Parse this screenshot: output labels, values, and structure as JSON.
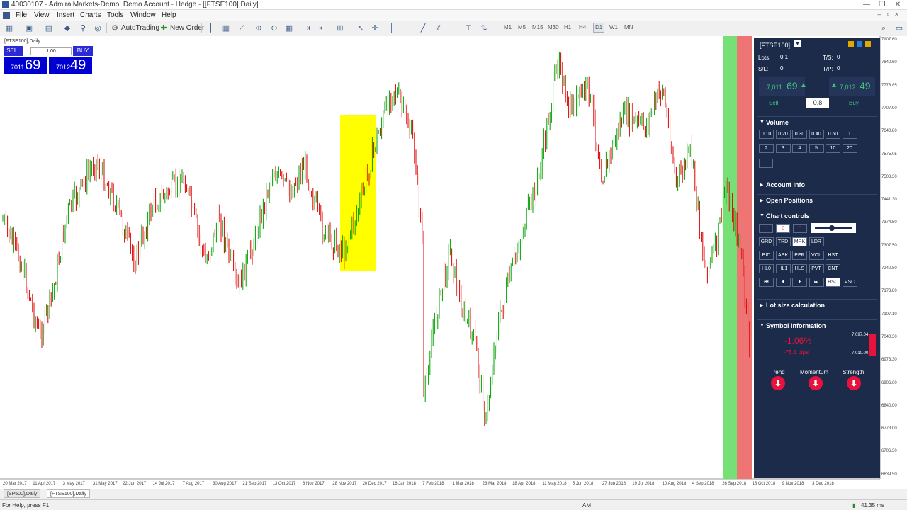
{
  "window": {
    "title": "40030107 - AdmiralMarkets-Demo: Demo Account - Hedge - [[FTSE100],Daily]",
    "controls": [
      "—",
      "❐",
      "✕"
    ]
  },
  "menu": [
    "File",
    "View",
    "Insert",
    "Charts",
    "Tools",
    "Window",
    "Help"
  ],
  "toolbar": {
    "autotrading_label": "AutoTrading",
    "new_order_label": "New Order",
    "timeframes": [
      "M1",
      "M5",
      "M15",
      "M30",
      "H1",
      "H4",
      "D1",
      "W1",
      "MN"
    ],
    "active_timeframe": "D1"
  },
  "chart": {
    "tag": "[FTSE100],Daily",
    "y_ticks": [
      "7907.60",
      "7840.60",
      "7773.85",
      "7707.90",
      "7640.80",
      "7575.05",
      "7508.30",
      "7441.30",
      "7374.50",
      "7307.50",
      "7240.80",
      "7173.80",
      "7107.10",
      "7040.30",
      "6973.30",
      "6906.60",
      "6840.00",
      "6773.00",
      "6706.30",
      "6639.50"
    ],
    "x_ticks": [
      "20 Mar 2017",
      "11 Apr 2017",
      "3 May 2017",
      "31 May 2017",
      "22 Jun 2017",
      "14 Jul 2017",
      "7 Aug 2017",
      "30 Aug 2017",
      "21 Sep 2017",
      "13 Oct 2017",
      "6 Nov 2017",
      "28 Nov 2017",
      "20 Dec 2017",
      "16 Jan 2018",
      "7 Feb 2018",
      "1 Mar 2018",
      "23 Mar 2018",
      "18 Apr 2018",
      "11 May 2018",
      "5 Jun 2018",
      "27 Jun 2018",
      "19 Jul 2018",
      "10 Aug 2018",
      "4 Sep 2018",
      "26 Sep 2018",
      "18 Oct 2018",
      "9 Nov 2018",
      "3 Dec 2018"
    ],
    "highlight_color": "#ffff00",
    "strip_colors": [
      "#6dde6d",
      "#ee6b6b"
    ]
  },
  "one_click": {
    "sell_label": "SELL",
    "buy_label": "BUY",
    "lots": "1.00",
    "sell_small": "7011",
    "sell_big": "69",
    "buy_small": "7012",
    "buy_big": "49"
  },
  "panel": {
    "symbol": "[FTSE100]",
    "lots_label": "Lots:",
    "lots_value": "0.1",
    "sl_label": "S/L:",
    "sl_value": "0",
    "ts_label": "T/S:",
    "ts_value": "0",
    "tp_label": "T/P:",
    "tp_value": "0",
    "sell_price_small": "7,011.",
    "sell_price_big": "69",
    "buy_price_small": "7,012.",
    "buy_price_big": "49",
    "sell_label": "Sell",
    "buy_label": "Buy",
    "spread": "0.8",
    "volume_title": "Volume",
    "volume_row1": [
      "0.10",
      "0.20",
      "0.30",
      "0.40",
      "0.50",
      "1"
    ],
    "volume_row2": [
      "2",
      "3",
      "4",
      "5",
      "10",
      "20"
    ],
    "volume_more": "...",
    "account_info": "Account info",
    "open_positions": "Open Positions",
    "chart_controls": "Chart controls",
    "cc_row1": [
      "GRD",
      "TRD",
      "MRK",
      "LDR"
    ],
    "cc_row2": [
      "BID",
      "ASK",
      "PER",
      "VOL",
      "HST"
    ],
    "cc_row3": [
      "HL0",
      "HL1",
      "HLS",
      "PVT",
      "CNT"
    ],
    "cc_row4": [
      "⏮",
      "⏴",
      "⏵",
      "⏭",
      "HSC",
      "VSC"
    ],
    "lot_size_calc": "Lot size calculation",
    "symbol_info": "Symbol information",
    "change_pct": "-1.06%",
    "change_pips": "-75.1 pips",
    "high_value": "7,097.04",
    "low_value": "7,010.00",
    "trend_label": "Trend",
    "momentum_label": "Momentum",
    "strength_label": "Strength",
    "accent_red": "#e8123c"
  },
  "tabs": [
    "[SP500],Daily",
    "[FTSE100],Daily"
  ],
  "status": {
    "help": "For Help, press F1",
    "mode": "AM",
    "ping": "41.35 ms"
  }
}
